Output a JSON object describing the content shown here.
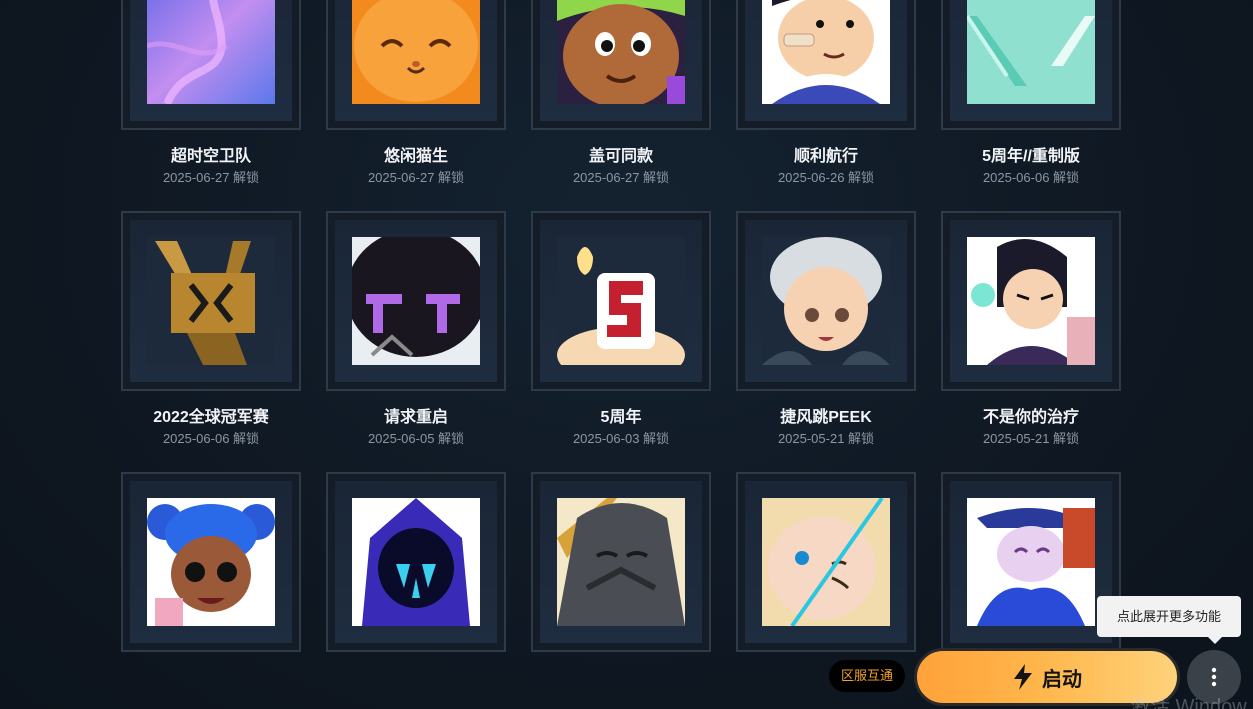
{
  "items": [
    {
      "title": "超时空卫队",
      "date": "2025-06-27 解锁",
      "icon": "purple-abstract-avatar"
    },
    {
      "title": "悠闲猫生",
      "date": "2025-06-27 解锁",
      "icon": "orange-cat-avatar"
    },
    {
      "title": "盖可同款",
      "date": "2025-06-27 解锁",
      "icon": "green-hair-boy-avatar"
    },
    {
      "title": "顺利航行",
      "date": "2025-06-26 解锁",
      "icon": "bandage-boy-avatar"
    },
    {
      "title": "5周年//重制版",
      "date": "2025-06-06 解锁",
      "icon": "teal-v-logo-avatar"
    },
    {
      "title": "2022全球冠军赛",
      "date": "2025-06-06 解锁",
      "icon": "gold-trophy-avatar"
    },
    {
      "title": "请求重启",
      "date": "2025-06-05 解锁",
      "icon": "dark-robot-avatar"
    },
    {
      "title": "5周年",
      "date": "2025-06-03 解锁",
      "icon": "birthday-candle-5-avatar"
    },
    {
      "title": "捷风跳PEEK",
      "date": "2025-05-21 解锁",
      "icon": "white-hair-girl-avatar"
    },
    {
      "title": "不是你的治疗",
      "date": "2025-05-21 解锁",
      "icon": "healer-girl-avatar"
    },
    {
      "title": "",
      "date": "",
      "icon": "blue-pigtail-girl-avatar"
    },
    {
      "title": "",
      "date": "",
      "icon": "hooded-blue-figure-avatar"
    },
    {
      "title": "",
      "date": "",
      "icon": "grey-masked-figure-avatar"
    },
    {
      "title": "",
      "date": "",
      "icon": "round-face-line-avatar"
    },
    {
      "title": "",
      "date": "",
      "icon": "blue-hat-cowboy-avatar"
    }
  ],
  "tooltip": {
    "text": "点此展开更多功能"
  },
  "server_badge": {
    "label": "区服互通"
  },
  "launch_button": {
    "label": "启动",
    "icon": "lightning-bolt-icon"
  },
  "more_button": {
    "icon": "vertical-dots-icon"
  },
  "watermark": {
    "text": "激活 Window"
  },
  "colors": {
    "background": "#0f1822",
    "card_border": "#2d3a4a",
    "accent_orange": "#ffa23a",
    "badge_text": "#f4a224"
  }
}
